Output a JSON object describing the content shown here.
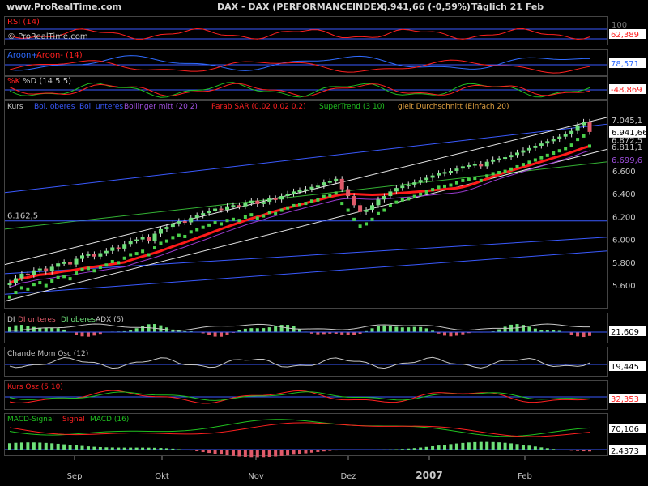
{
  "header": {
    "site": "www.ProRealTime.com",
    "instrument": "DAX - DAX (PERFORMANCEINDEX)",
    "quote": "6.941,66 (-0,59%)",
    "period": "Täglich  21 Feb"
  },
  "colors": {
    "background": "#000000",
    "panel_border": "#2a2a2a",
    "header_bg": "#c8c8c8",
    "value_box": "#ffffff",
    "bullish": "#6ee07a",
    "bearish": "#e05a6a",
    "supertrend": "#4ad04a",
    "sar_red": "#ff1a1a",
    "bollinger": "#e6e6e6",
    "blue_line": "#3a5aff",
    "purple_line": "#9a3ad0",
    "green_line": "#34b234",
    "red_text": "#ff2020",
    "blue_text": "#2f6bff",
    "violet_text": "#a050e0",
    "green_text": "#20c020",
    "orange_text": "#e0a040"
  },
  "chart_data": [
    {
      "type": "line",
      "panel": "RSI (14)",
      "title_parts": [
        "RSI (14)"
      ],
      "watermark": "© ProRealTime.com",
      "last_value": "62,389",
      "scale_top": "100"
    },
    {
      "type": "line",
      "panel": "Aroon",
      "title_parts": [
        "Aroon+",
        "Aroon- (14)"
      ],
      "last_value": "78,571"
    },
    {
      "type": "line",
      "panel": "Stochastic",
      "title_parts": [
        "%K",
        "%D (14 5 5)"
      ],
      "last_value": "-48,869"
    },
    {
      "type": "candlestick",
      "panel": "Kurs",
      "title_parts": [
        "Kurs",
        "Bol. oberes",
        "Bol. unteres",
        "Bollinger mitt (20 2)",
        "Parab SAR (0,02 0,02 0,2)",
        "SuperTrend (3 10)",
        "gleit Durchschnitt (Einfach 20)"
      ],
      "price_labels": [
        "7.045,1",
        "6.941,66",
        "6.872,5",
        "6.811,1",
        "6.699,6"
      ],
      "y_ticks": [
        "6.600",
        "6.400",
        "6.200",
        "6.000",
        "5.800",
        "5.600"
      ],
      "y_tick_values": [
        6600,
        6400,
        6200,
        6000,
        5800,
        5600
      ],
      "ylim": [
        5400,
        7100
      ],
      "left_label": "6.162,5",
      "left_label_value": 6162.5,
      "closes": [
        5620,
        5660,
        5700,
        5690,
        5730,
        5745,
        5720,
        5760,
        5790,
        5800,
        5780,
        5830,
        5860,
        5870,
        5850,
        5880,
        5900,
        5930,
        5920,
        5960,
        5990,
        6000,
        6020,
        5990,
        6050,
        6090,
        6110,
        6140,
        6160,
        6150,
        6190,
        6210,
        6230,
        6250,
        6270,
        6260,
        6290,
        6300,
        6290,
        6320,
        6340,
        6310,
        6330,
        6360,
        6350,
        6380,
        6400,
        6420,
        6430,
        6440,
        6460,
        6470,
        6500,
        6510,
        6530,
        6440,
        6380,
        6300,
        6240,
        6260,
        6300,
        6350,
        6380,
        6420,
        6450,
        6470,
        6480,
        6500,
        6520,
        6540,
        6560,
        6580,
        6590,
        6600,
        6620,
        6640,
        6650,
        6660,
        6640,
        6680,
        6700,
        6710,
        6720,
        6740,
        6760,
        6780,
        6800,
        6820,
        6840,
        6860,
        6880,
        6900,
        6920,
        6950,
        7000,
        7030,
        6941
      ]
    },
    {
      "type": "bar",
      "panel": "ADX",
      "title_parts": [
        "DI",
        "DI unteres",
        "DI oberes",
        "ADX (5)"
      ],
      "last_value": "21,609"
    },
    {
      "type": "line",
      "panel": "Chande Mom Osc",
      "title_parts": [
        "Chande Mom Osc (12)"
      ],
      "last_value": "19,445"
    },
    {
      "type": "line",
      "panel": "Kurs Osz",
      "title_parts": [
        "Kurs Osz (5 10)"
      ],
      "last_value": "32,353"
    },
    {
      "type": "bar",
      "panel": "MACD",
      "title_parts": [
        "MACD-Signal",
        "Signal",
        "MACD (16)"
      ],
      "last_value_1": "70,106",
      "last_value_2": "2,4373"
    }
  ],
  "x_axis": {
    "labels": [
      "Sep",
      "Okt",
      "Nov",
      "Dez",
      "2007",
      "Feb"
    ]
  }
}
